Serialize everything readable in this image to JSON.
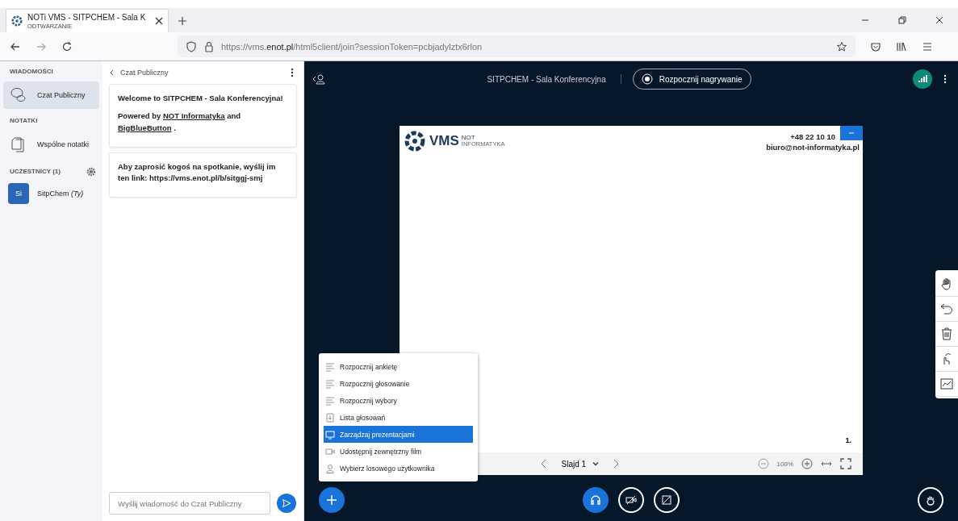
{
  "browser": {
    "tab_title": "NOTi VMS - SITPCHEM - Sala K",
    "tab_subtitle": "ODTWARZANIE",
    "url_prefix": "https://vms.",
    "url_domain": "enot.pl",
    "url_rest": "/html5client/join?sessionToken=pcbjadylztx6rlon"
  },
  "sidebar": {
    "sections": [
      {
        "title": "WIADOMOŚCI",
        "items": [
          {
            "label": "Czat Publiczny",
            "kind": "chat",
            "selected": true
          }
        ]
      },
      {
        "title": "NOTATKI",
        "items": [
          {
            "label": "Wspólne notatki",
            "kind": "notes",
            "selected": false
          }
        ]
      }
    ],
    "participants_title": "UCZESTNICY (1)",
    "users": [
      {
        "initials": "Si",
        "name": "SitpChem",
        "suffix": "(Ty)"
      }
    ]
  },
  "chat": {
    "title": "Czat Publiczny",
    "messages": [
      {
        "paragraphs": [
          [
            {
              "text": "Welcome to SITPCHEM - Sala Konferencyjna!",
              "link": false
            }
          ],
          [
            {
              "text": "Powered by",
              "link": false
            },
            {
              "text": "NOT Informatyka",
              "link": true
            },
            {
              "text": "and",
              "link": false
            },
            {
              "text": "BigBlueButton",
              "link": true
            },
            {
              "text": ".",
              "link": false
            }
          ]
        ]
      },
      {
        "paragraphs": [
          [
            {
              "text": "Aby zaprosić kogoś na spotkanie, wyślij im ten link: https://vms.enot.pl/b/sitggj-smj",
              "link": false
            }
          ]
        ]
      }
    ],
    "input_placeholder": "Wyślij wiadomość do Czat Publiczny"
  },
  "meeting": {
    "title": "SITPCHEM - Sala Konferencyjna",
    "record_button": "Rozpocznij nagrywanie"
  },
  "slide": {
    "logo_text": "VMS",
    "logo_small_top": "NOT",
    "logo_small_bottom": "INFORMATYKA",
    "phone": "+48 22 10 10",
    "email": "biuro@not-informatyka.pl",
    "page_number": "1.",
    "slide_label": "Slajd 1",
    "zoom": "100%"
  },
  "actions_menu": [
    {
      "label": "Rozpocznij ankietę",
      "kind": "list",
      "selected": false
    },
    {
      "label": "Rozpocznij głosowanie",
      "kind": "list",
      "selected": false
    },
    {
      "label": "Rozpocznij wybory",
      "kind": "list",
      "selected": false
    },
    {
      "label": "Lista głosowań",
      "kind": "download",
      "selected": false
    },
    {
      "label": "Zarządzaj prezentacjami",
      "kind": "screen",
      "selected": true
    },
    {
      "label": "Udostępnij zewnętrzny film",
      "kind": "video",
      "selected": false
    },
    {
      "label": "Wybierz losowego użytkownika",
      "kind": "user",
      "selected": false
    }
  ]
}
